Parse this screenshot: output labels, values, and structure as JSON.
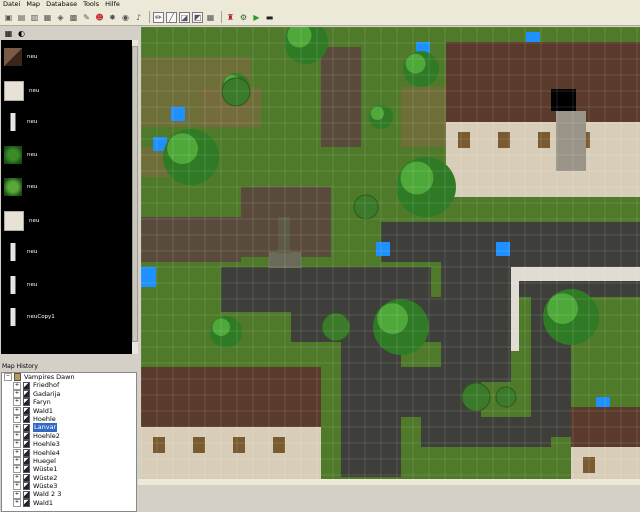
{
  "menu": [
    "Datei",
    "Map",
    "Database",
    "Tools",
    "Hilfe"
  ],
  "toolbar": {
    "icons": [
      "new-map-icon",
      "open-icon",
      "save-icon",
      "tileset-icon",
      "dungeon-icon",
      "database-icon",
      "script-icon",
      "character-icon",
      "resource-icon",
      "world-icon",
      "music-icon",
      "pencil-icon",
      "line-icon",
      "fill-icon",
      "eraser-icon",
      "grid-icon",
      "test-character-icon",
      "settings-icon",
      "play-icon",
      "fullscreen-icon"
    ]
  },
  "tileset_panel": {
    "items": [
      {
        "label": "neu",
        "kind": "roof"
      },
      {
        "label": "neu",
        "kind": "wall"
      },
      {
        "label": "neu",
        "kind": "pillar"
      },
      {
        "label": "neu",
        "kind": "grass"
      },
      {
        "label": "neu",
        "kind": "tree"
      },
      {
        "label": "neu",
        "kind": "wall"
      },
      {
        "label": "neu",
        "kind": "pillar"
      },
      {
        "label": "neu",
        "kind": "pillar"
      },
      {
        "label": "neuCopy1",
        "kind": "pillar"
      }
    ]
  },
  "map_history": {
    "label": "Map History",
    "items": [
      {
        "label": "Vampires Dawn",
        "level": 0,
        "expanded": true,
        "selected": false
      },
      {
        "label": "Friedhof",
        "level": 1,
        "selected": false
      },
      {
        "label": "Gadarija",
        "level": 1,
        "selected": false
      },
      {
        "label": "Faryn",
        "level": 1,
        "selected": false
      },
      {
        "label": "Wald1",
        "level": 1,
        "selected": false
      },
      {
        "label": "Hoehle",
        "level": 1,
        "selected": false
      },
      {
        "label": "Lanvar",
        "level": 1,
        "selected": true
      },
      {
        "label": "Hoehle2",
        "level": 1,
        "selected": false
      },
      {
        "label": "Hoehle3",
        "level": 1,
        "selected": false
      },
      {
        "label": "Hoehle4",
        "level": 1,
        "selected": false
      },
      {
        "label": "Huegel",
        "level": 1,
        "selected": false
      },
      {
        "label": "Wüste1",
        "level": 1,
        "selected": false
      },
      {
        "label": "Wüste2",
        "level": 1,
        "selected": false
      },
      {
        "label": "Wüste3",
        "level": 1,
        "selected": false
      },
      {
        "label": "Wald 2 3",
        "level": 1,
        "selected": false
      },
      {
        "label": "Wald1",
        "level": 1,
        "selected": false
      }
    ]
  },
  "colors": {
    "grass": "#4e7a2a",
    "path": "#3e3e3a",
    "roof": "#5a3a2a",
    "wall": "#d8cdb8",
    "water": "#1e90ff",
    "tree": "#2f7a24"
  }
}
